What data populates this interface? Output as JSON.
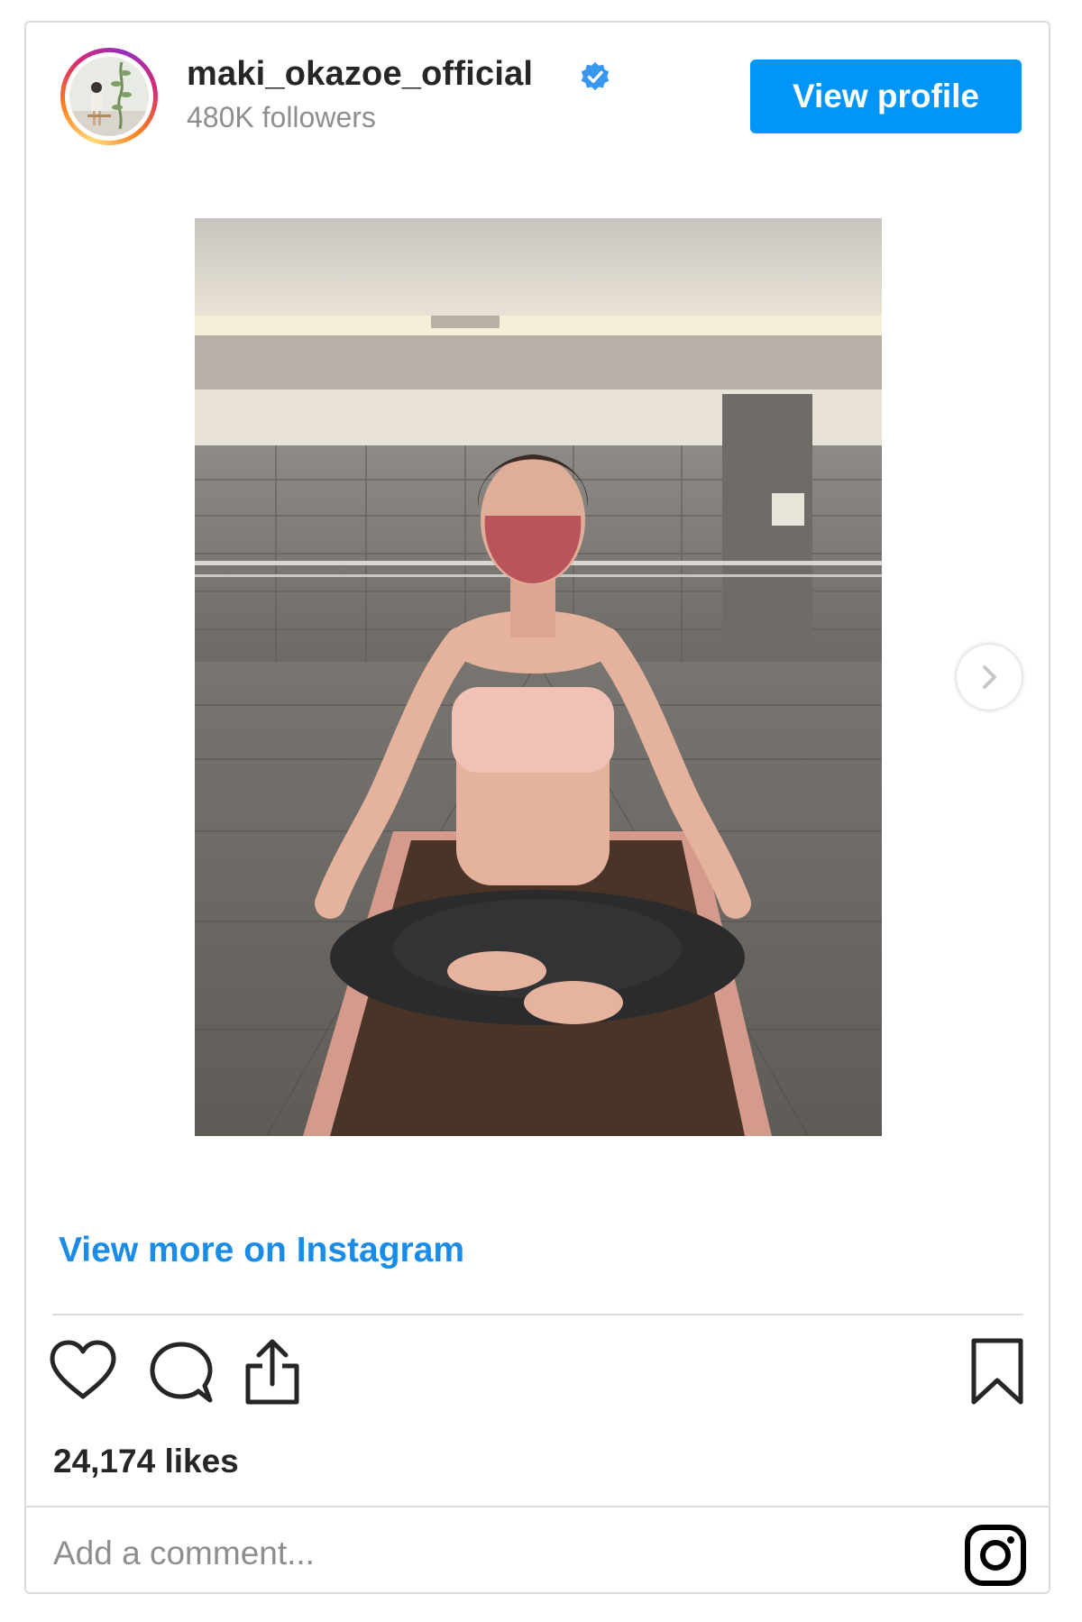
{
  "header": {
    "username": "maki_okazoe_official",
    "followers": "480K followers",
    "view_profile_label": "View profile",
    "verified_icon": "verified-badge-icon"
  },
  "post": {
    "view_more_label": "View more on Instagram",
    "likes": "24,174 likes",
    "comment_placeholder": "Add a comment..."
  },
  "icons": {
    "like": "heart-icon",
    "comment": "comment-bubble-icon",
    "share": "share-icon",
    "save": "bookmark-icon",
    "next": "chevron-right-icon",
    "brand": "instagram-logo-icon"
  },
  "colors": {
    "accent": "#0095f6",
    "link": "#1a8ce8",
    "text": "#262626",
    "muted": "#8e8e8e",
    "border": "#dbdbdb"
  }
}
